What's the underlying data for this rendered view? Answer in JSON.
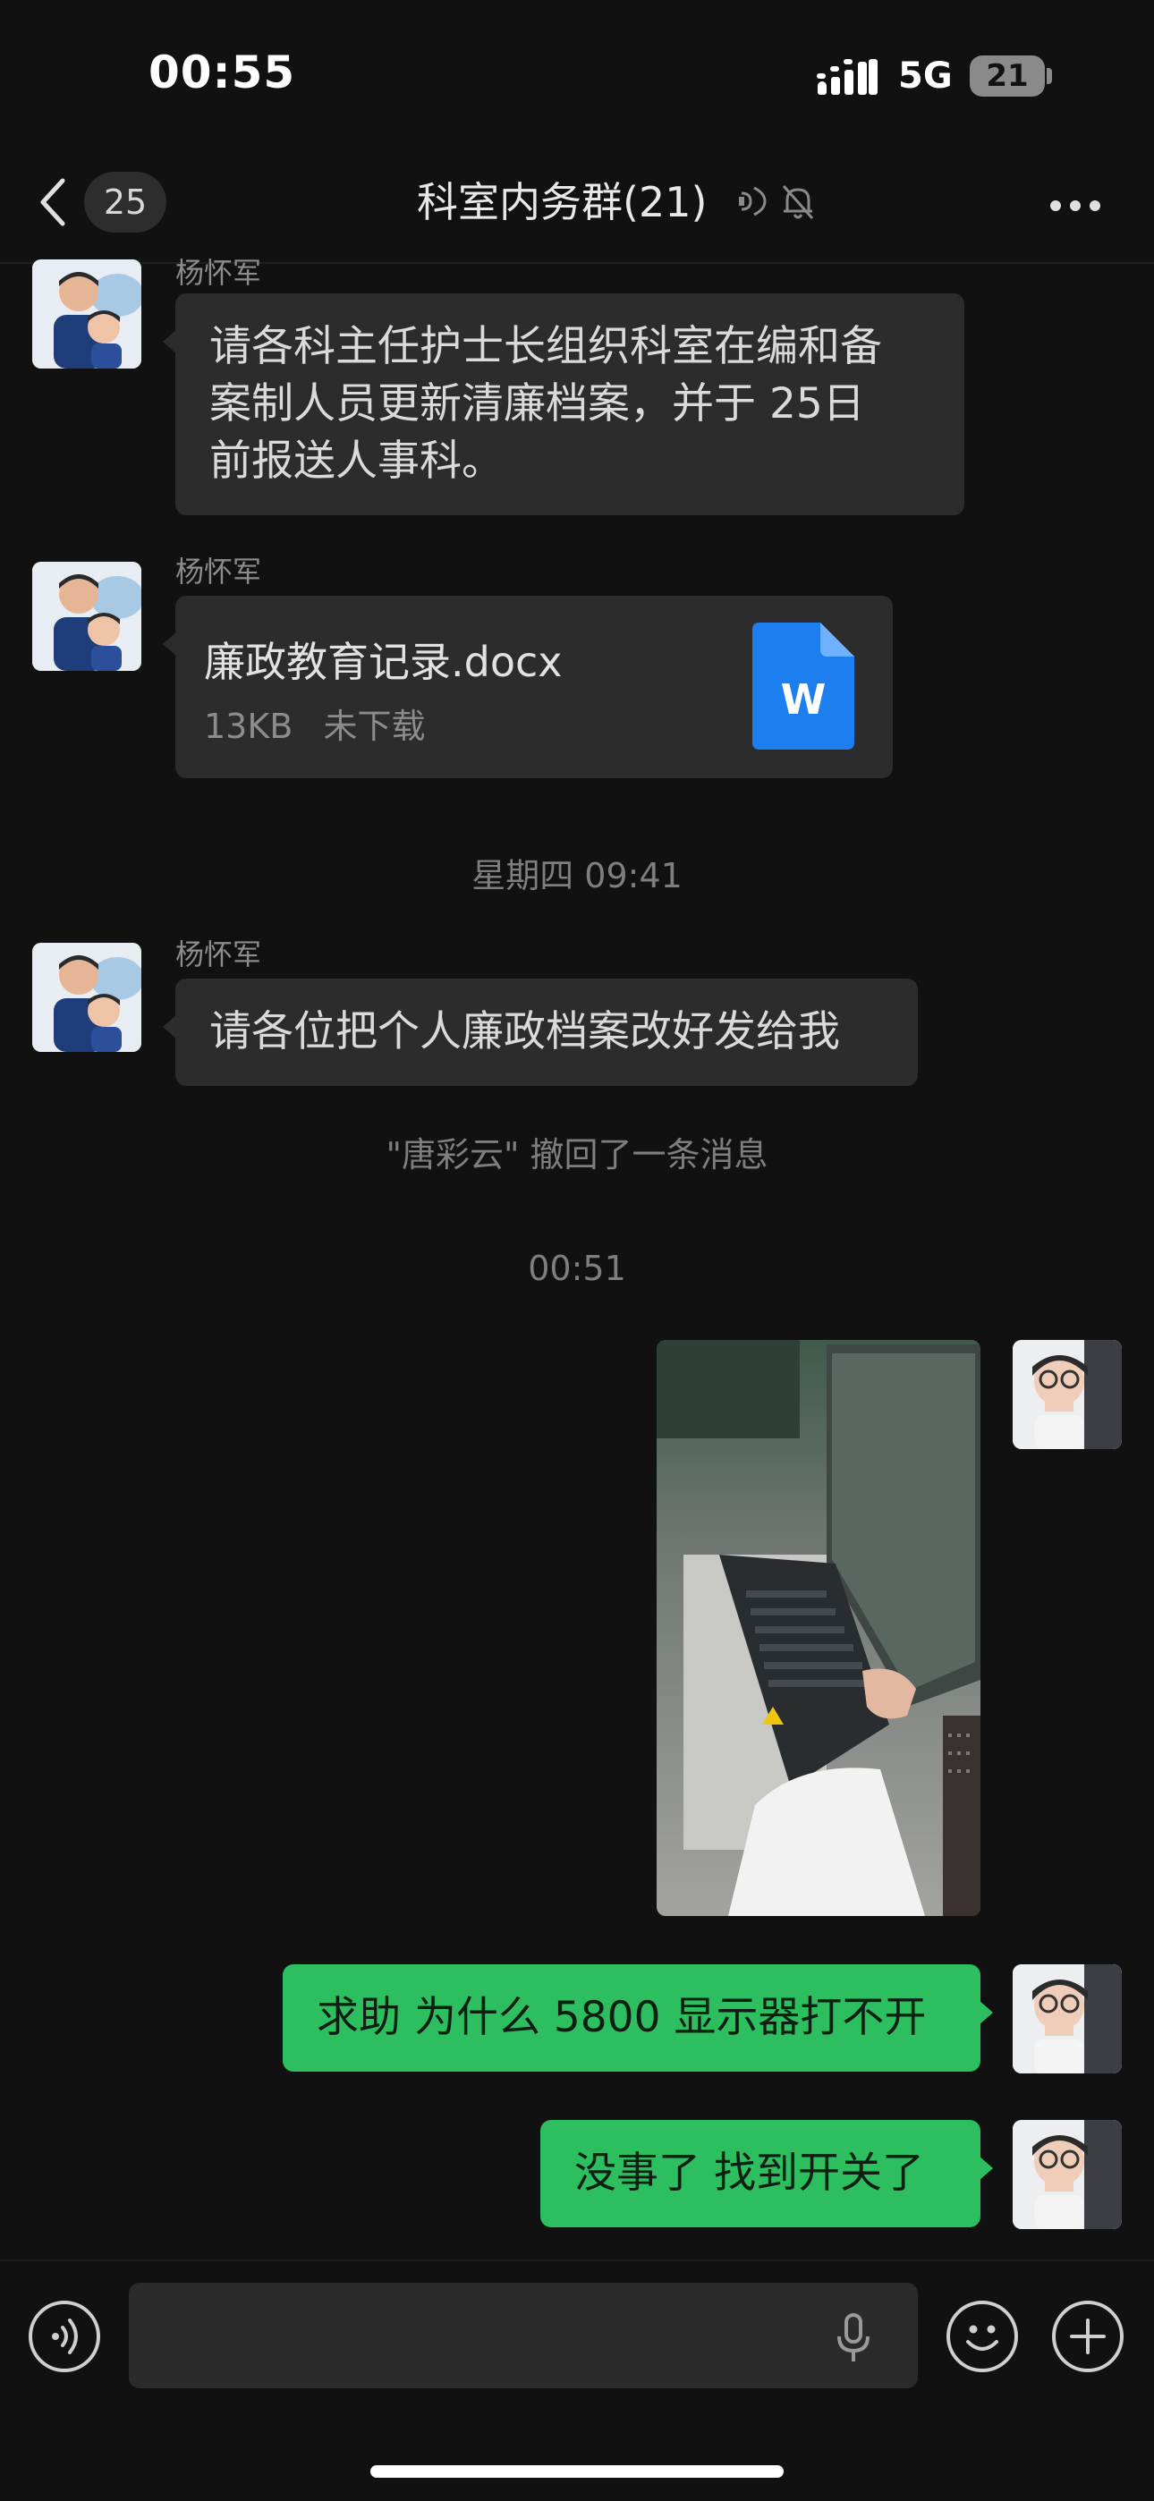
{
  "status_bar": {
    "time": "00:55",
    "network": "5G",
    "battery": "21"
  },
  "nav": {
    "unread_count": "25",
    "title": "科室内务群(21)"
  },
  "messages": [
    {
      "sender": "杨怀军",
      "lines": [
        "请各科主任护士长组织科室在编和备",
        "案制人员更新清廉档案，并于 25日",
        "前报送人事科。"
      ]
    },
    {
      "sender": "杨怀军",
      "file_name": "廉政教育记录.docx",
      "file_size": "13KB",
      "file_status": "未下载",
      "file_icon_letter": "W"
    },
    {
      "timestamp": "星期四 09:41"
    },
    {
      "sender": "杨怀军",
      "text": "请各位把个人廉政档案改好发给我"
    },
    {
      "system": "\"唐彩云\" 撤回了一条消息"
    },
    {
      "timestamp": "00:51"
    },
    {
      "self_text": "求助 为什么 5800 显示器打不开"
    },
    {
      "self_text": "没事了 找到开关了"
    }
  ],
  "colors": {
    "background": "#111111",
    "bubble_other": "#2c2c2c",
    "bubble_self": "#2dbe60",
    "file_icon": "#1d7ef0"
  }
}
